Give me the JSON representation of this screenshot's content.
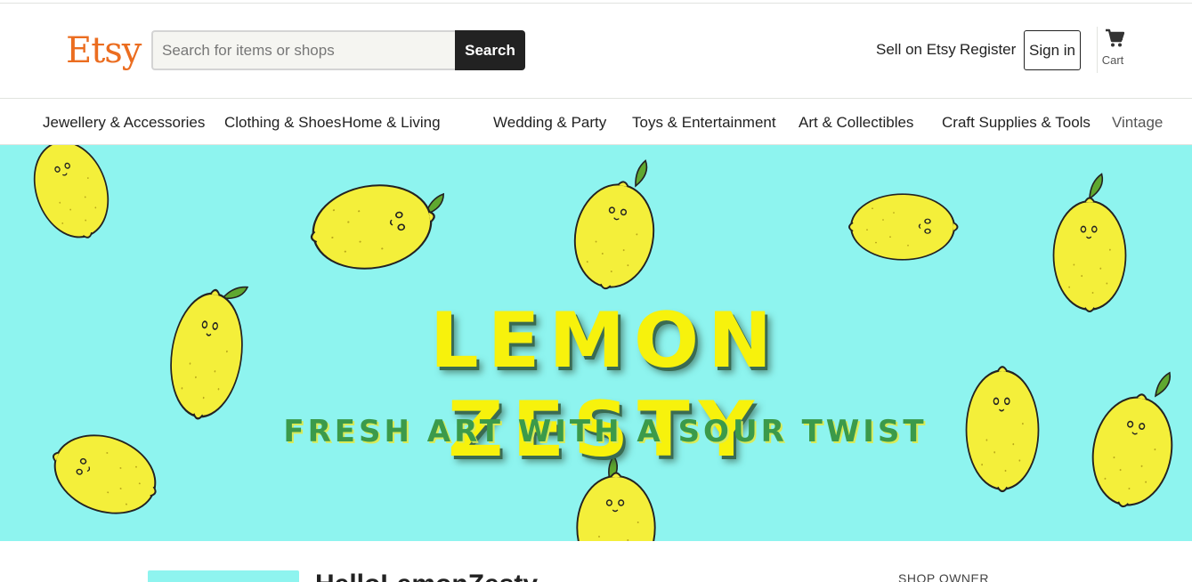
{
  "header": {
    "logo": "Etsy",
    "search": {
      "placeholder": "Search for items or shops",
      "value": "",
      "button_label": "Search"
    },
    "links": {
      "sell": "Sell on Etsy",
      "register": "Register",
      "sign_in": "Sign in"
    },
    "cart_label": "Cart",
    "cart_icon": "cart-icon"
  },
  "categories": [
    "Jewellery & Accessories",
    "Clothing & Shoes",
    "Home & Living",
    "Wedding & Party",
    "Toys & Entertainment",
    "Art & Collectibles",
    "Craft Supplies & Tools",
    "Vintage"
  ],
  "banner": {
    "title": "LEMON ZESTY",
    "subtitle": "FRESH ART WITH A SOUR TWIST",
    "colors": {
      "background": "#8ef4ef",
      "title": "#f7f20c",
      "subtitle": "#3b9a4a",
      "lemon": "#f4ef3a"
    }
  },
  "shop": {
    "name": "HelloLemonZesty",
    "owner_label": "SHOP OWNER"
  },
  "colors": {
    "brand": "#eb6d20",
    "search_button": "#222222"
  }
}
